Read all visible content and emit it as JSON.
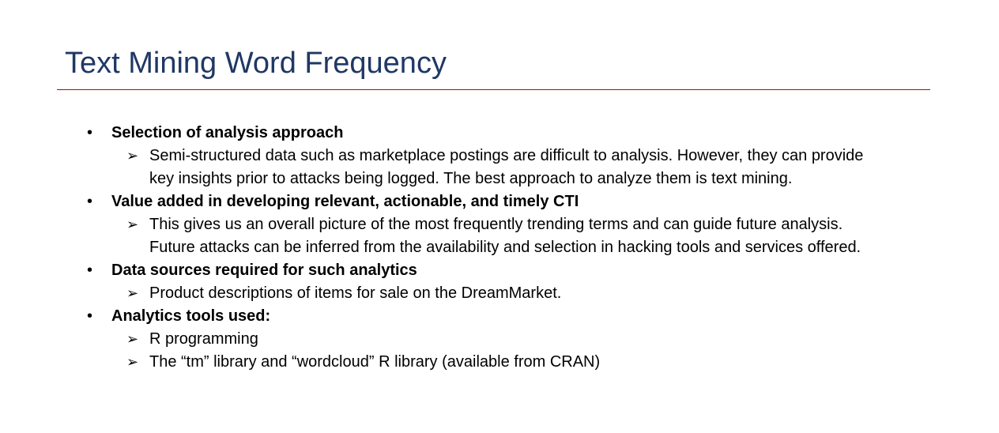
{
  "slide": {
    "title": "Text Mining Word Frequency",
    "accent_color": "#c00000",
    "title_color": "#1f3864",
    "bullets": [
      {
        "heading": "Selection of analysis approach",
        "items": [
          "Semi-structured data such as marketplace postings are difficult to analysis. However, they can provide key insights prior to attacks being logged. The best approach to analyze them is text mining."
        ]
      },
      {
        "heading": "Value added in developing relevant, actionable, and timely CTI",
        "items": [
          "This gives us an overall picture of the most frequently trending terms and can guide future analysis. Future attacks can be inferred from the availability and selection in hacking tools and services offered."
        ]
      },
      {
        "heading": "Data sources required for such analytics",
        "items": [
          "Product descriptions of items for sale on the DreamMarket."
        ]
      },
      {
        "heading": "Analytics tools used:",
        "items": [
          "R programming",
          "The “tm” library and “wordcloud” R library (available from CRAN)"
        ]
      }
    ]
  }
}
